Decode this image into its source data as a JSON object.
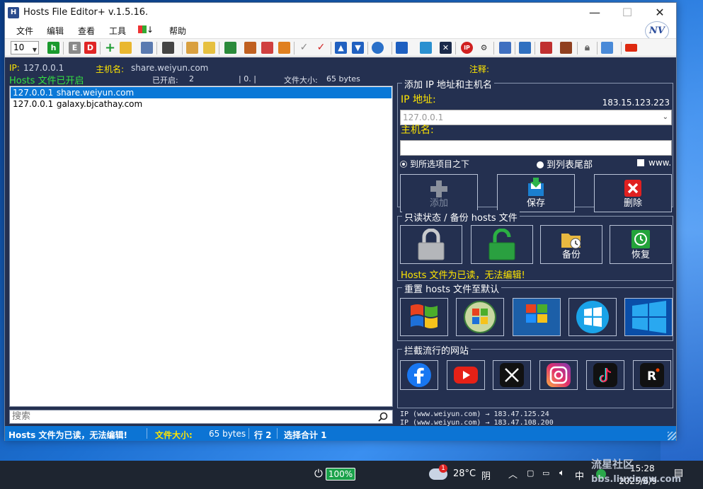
{
  "window": {
    "title": "Hosts File Editor+ v.1.5.16.",
    "logo_text": "NV"
  },
  "menu": [
    "文件",
    "编辑",
    "查看",
    "工具",
    "↓",
    "帮助"
  ],
  "toolbar": {
    "font_size_value": "10"
  },
  "info_bar": {
    "ip_label": "IP:",
    "ip_value": "127.0.0.1",
    "host_label": "主机名:",
    "host_value": "share.weiyun.com",
    "comment_label": "注释:"
  },
  "sub_bar": {
    "status": "Hosts 文件已开启",
    "enabled_label": "已开启:",
    "enabled_value": "2",
    "disabled_value": "| 0. |",
    "size_label": "文件大小:",
    "size_value": "65 bytes"
  },
  "entries": [
    {
      "ip": "127.0.0.1",
      "host": "share.weiyun.com",
      "selected": true
    },
    {
      "ip": "127.0.0.1",
      "host": "galaxy.bjcathay.com",
      "selected": false
    }
  ],
  "search": {
    "placeholder": "搜索"
  },
  "add_panel": {
    "legend": "添加 IP 地址和主机名",
    "ip_label": "IP 地址:",
    "external_ip": "183.15.123.223",
    "ip_placeholder": "127.0.0.1",
    "host_label": "主机名:",
    "radio_below": "到所选项目之下",
    "radio_end": "到列表尾部",
    "www_label": "www.",
    "btn_add": "添加",
    "btn_save": "保存",
    "btn_delete": "删除"
  },
  "readonly_panel": {
    "legend": "只读状态 / 备份 hosts 文件",
    "btn_backup": "备份",
    "btn_restore": "恢复",
    "message": "Hosts 文件为已读，无法编辑!"
  },
  "reset_panel": {
    "legend": "重置 hosts 文件至默认",
    "logos": [
      "Windows XP",
      "Vista",
      "Windows 7",
      "Windows 8",
      "Windows 10, 11"
    ]
  },
  "block_panel": {
    "legend": "拦截流行的网站",
    "sites": [
      "facebook",
      "youtube",
      "x",
      "instagram",
      "tiktok",
      "reddit"
    ]
  },
  "ip_info": [
    "IP (www.weiyun.com) → 183.47.125.24",
    "IP (www.weiyun.com) → 183.47.108.200"
  ],
  "statusbar": {
    "msg": "Hosts 文件为已读，无法编辑!",
    "size_label": "文件大小:",
    "size_value": "65 bytes",
    "line": "行 2",
    "selection": "选择合计 1"
  },
  "taskbar": {
    "battery": "100%",
    "weather_badge": "1",
    "temperature": "28°C",
    "weather": "阴",
    "ime": "中",
    "time": "15:28",
    "date": "2025/6/9"
  },
  "watermark": {
    "line1": "流星社区",
    "line2": "bbs.liuxingw.com"
  },
  "colors": {
    "panel_bg": "#243050",
    "highlight": "#ffe600",
    "green": "#33e040",
    "status_blue": "#0c74d4"
  }
}
